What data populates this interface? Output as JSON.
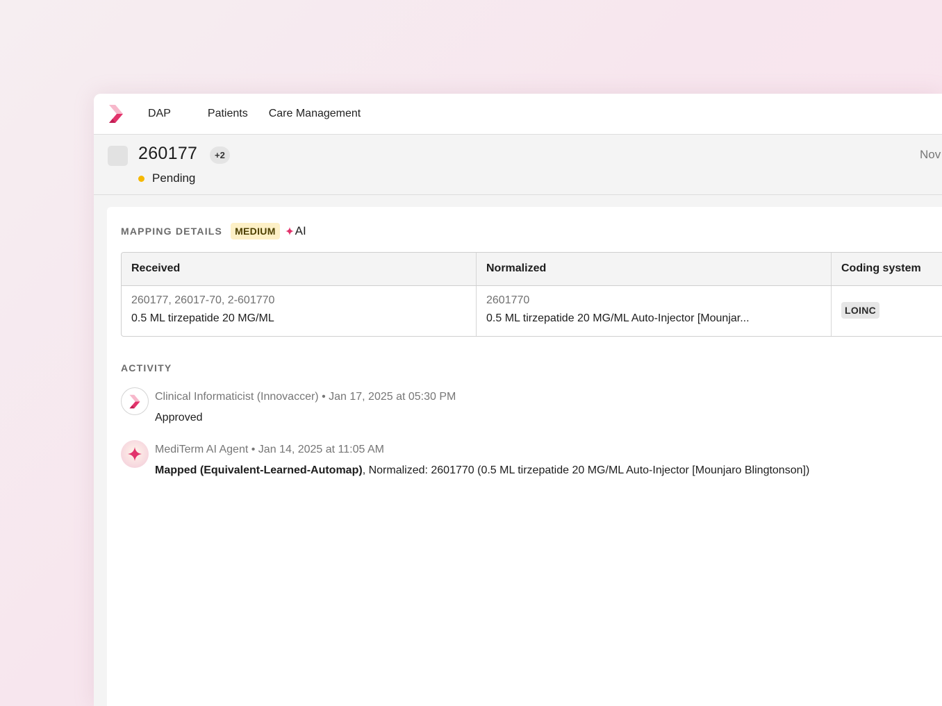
{
  "nav": {
    "app_name": "DAP",
    "items": [
      "Patients",
      "Care Management"
    ]
  },
  "header": {
    "record_id": "260177",
    "extra_count": "+2",
    "status": "Pending",
    "date_partial": "Nov"
  },
  "mapping": {
    "title": "MAPPING DETAILS",
    "confidence_badge": "MEDIUM",
    "ai_label": "AI",
    "columns": [
      "Received",
      "Normalized",
      "Coding system"
    ],
    "row": {
      "received_codes": "260177, 26017-70, 2-601770",
      "received_desc": "0.5 ML tirzepatide 20 MG/ML",
      "normalized_code": "2601770",
      "normalized_desc": "0.5 ML tirzepatide 20 MG/ML Auto-Injector [Mounjar...",
      "coding_system": "LOINC"
    }
  },
  "activity": {
    "title": "ACTIVITY",
    "entries": [
      {
        "actor": "Clinical Informaticist (Innovaccer)",
        "timestamp": "Jan 17, 2025 at 05:30 PM",
        "action": "Approved",
        "detail": "",
        "icon": "innovaccer-logo-icon"
      },
      {
        "actor": "MediTerm AI Agent",
        "timestamp": "Jan 14, 2025 at 11:05 AM",
        "action": "Mapped (Equivalent-Learned-Automap)",
        "detail": ", Normalized: 2601770 (0.5 ML tirzepatide 20 MG/ML Auto-Injector [Mounjaro Blingtonson])",
        "icon": "ai-sparkle-icon"
      }
    ]
  },
  "colors": {
    "brand": "#e2336b",
    "status_pending": "#f5b800",
    "medium_badge_bg": "#fdf0c6"
  }
}
